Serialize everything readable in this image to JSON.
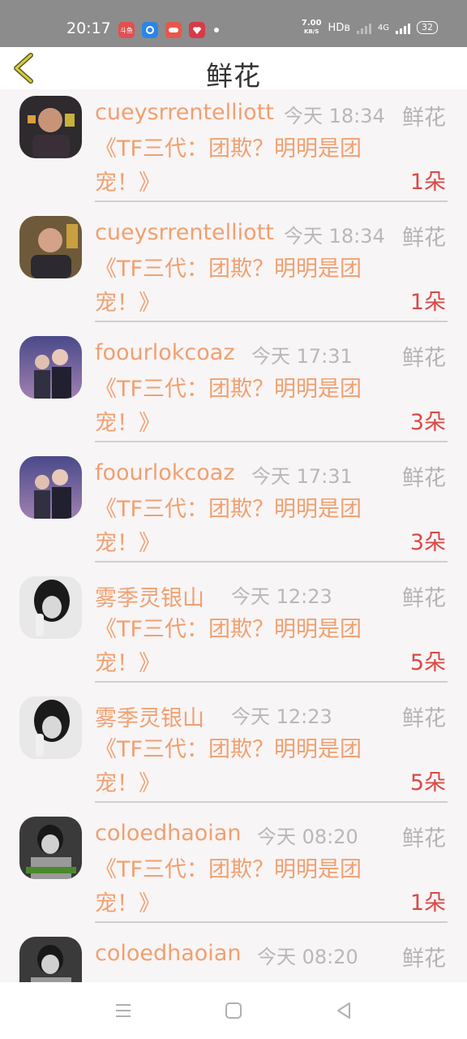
{
  "status_bar": {
    "time": "20:17",
    "apps": [
      {
        "icon": "app-icon-1",
        "label": "斗鱼",
        "color": "#e05050"
      },
      {
        "icon": "app-icon-2",
        "label": "",
        "color": "#2a86e8"
      },
      {
        "icon": "game-app-icon",
        "label": "",
        "color": "#e8564a"
      },
      {
        "icon": "app-icon-4",
        "label": "",
        "color": "#d83a48"
      }
    ],
    "net_speed": "7.00",
    "net_unit": "KB/S",
    "hd": "HDʙ",
    "network": "4G",
    "battery": "32"
  },
  "header": {
    "title": "鲜花",
    "back_icon": "back-chevron-icon"
  },
  "colors": {
    "name": "#f0a070",
    "count": "#d94a46",
    "muted": "#b8b8b8"
  },
  "gifts": [
    {
      "name": "cueysrrentelliott",
      "time": "今天 18:34",
      "type": "鲜花",
      "content": "《TF三代：团欺？明明是团宠！》",
      "count": "1朵"
    },
    {
      "name": "cueysrrentelliott",
      "time": "今天 18:34",
      "type": "鲜花",
      "content": "《TF三代：团欺？明明是团宠！》",
      "count": "1朵"
    },
    {
      "name": "foourlokcoaz",
      "time": "今天 17:31",
      "type": "鲜花",
      "content": "《TF三代：团欺？明明是团宠！》",
      "count": "3朵"
    },
    {
      "name": "foourlokcoaz",
      "time": "今天 17:31",
      "type": "鲜花",
      "content": "《TF三代：团欺？明明是团宠！》",
      "count": "3朵"
    },
    {
      "name": "雾季灵银山",
      "time": "今天 12:23",
      "type": "鲜花",
      "content": "《TF三代：团欺？明明是团宠！》",
      "count": "5朵"
    },
    {
      "name": "雾季灵银山",
      "time": "今天 12:23",
      "type": "鲜花",
      "content": "《TF三代：团欺？明明是团宠！》",
      "count": "5朵"
    },
    {
      "name": "coloedhaoian",
      "time": "今天 08:20",
      "type": "鲜花",
      "content": "《TF三代：团欺？明明是团宠！》",
      "count": "1朵"
    },
    {
      "name": "coloedhaoian",
      "time": "今天 08:20",
      "type": "鲜花",
      "content": "",
      "count": ""
    }
  ],
  "nav": {
    "menu_icon": "menu-icon",
    "home_icon": "home-icon",
    "back_icon": "back-triangle-icon"
  }
}
